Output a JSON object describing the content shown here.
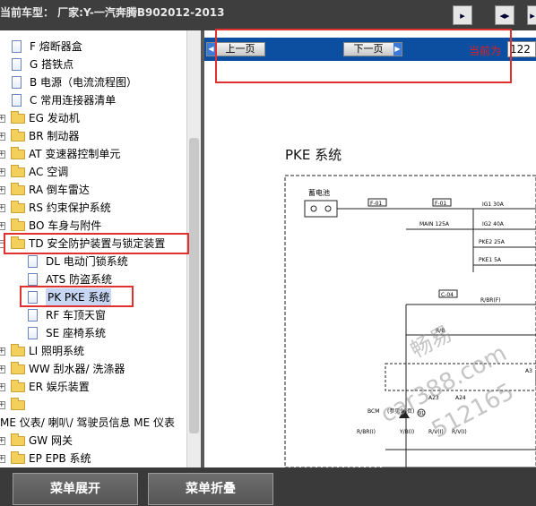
{
  "header": {
    "title": "当前车型：  厂家:Y-一汽奔腾B902012-2013",
    "buttons": [
      {
        "name": "collapse-left-button",
        "glyph": "▸"
      },
      {
        "name": "split-view-button",
        "glyph": "◂▸"
      },
      {
        "name": "expand-right-button",
        "glyph": "▸"
      }
    ]
  },
  "tree": {
    "items": [
      {
        "label": "F 熔断器盒",
        "type": "doc",
        "level": 1
      },
      {
        "label": "G 搭铁点",
        "type": "doc",
        "level": 1
      },
      {
        "label": "B 电源（电流流程图）",
        "type": "doc",
        "level": 1
      },
      {
        "label": "C 常用连接器清单",
        "type": "doc",
        "level": 1
      },
      {
        "label": "EG 发动机",
        "type": "folder",
        "level": 0
      },
      {
        "label": "BR 制动器",
        "type": "folder",
        "level": 0
      },
      {
        "label": "AT 变速器控制单元",
        "type": "folder",
        "level": 0
      },
      {
        "label": "AC 空调",
        "type": "folder",
        "level": 0
      },
      {
        "label": "RA 倒车雷达",
        "type": "folder",
        "level": 0
      },
      {
        "label": "RS 约束保护系统",
        "type": "folder",
        "level": 0
      },
      {
        "label": "BO 车身与附件",
        "type": "folder",
        "level": 0
      },
      {
        "label": "TD 安全防护装置与锁定装置",
        "type": "folder-open",
        "level": 0
      },
      {
        "label": "DL 电动门锁系统",
        "type": "doc",
        "level": 2
      },
      {
        "label": "ATS 防盗系统",
        "type": "doc",
        "level": 2
      },
      {
        "label": "PK PKE 系统",
        "type": "doc",
        "level": 2,
        "selected": true
      },
      {
        "label": "RF 车顶天窗",
        "type": "doc",
        "level": 2
      },
      {
        "label": "SE 座椅系统",
        "type": "doc",
        "level": 2
      },
      {
        "label": "LI 照明系统",
        "type": "folder",
        "level": 0
      },
      {
        "label": "WW 刮水器/ 洗涤器",
        "type": "folder",
        "level": 0
      },
      {
        "label": "ER 娱乐装置",
        "type": "folder",
        "level": 0
      },
      {
        "label": "",
        "type": "folder",
        "level": 0
      },
      {
        "label": "ME 仪表/ 喇叭/ 驾驶员信息 ME 仪表",
        "type": "text",
        "level": 0
      },
      {
        "label": "GW 网关",
        "type": "folder",
        "level": 0
      },
      {
        "label": "EP EPB 系统",
        "type": "folder",
        "level": 0
      }
    ]
  },
  "nav": {
    "prev_label": "上一页",
    "next_label": "下一页",
    "current_label": "当前为",
    "current_page": "122"
  },
  "diagram": {
    "title": "PKE 系统",
    "battery_label": "蓄电池",
    "labels": {
      "f01a": "F-01",
      "f01b": "F-01",
      "main": "MAIN 125A",
      "ig1": "IG1 30A",
      "ig2": "IG2 40A",
      "pke2": "PKE2 25A",
      "pke1": "PKE1 5A",
      "c04": "C-04",
      "rbrf": "R/BR(F)",
      "wire_rb": "R/B",
      "a3": "A3",
      "a23": "A23",
      "a24": "A24",
      "bcm": "BCM",
      "bcm_note": "(参见96页)",
      "conn_91": "91",
      "rbr": "R/BR(I)",
      "ybi": "Y/B(I)",
      "rvi": "R/V(I)",
      "rvi2": "R/V(I)"
    }
  },
  "watermark": {
    "line1": "畅易",
    "line2": "car388.com",
    "line3": "512165"
  },
  "footer": {
    "expand_label": "菜单展开",
    "collapse_label": "菜单折叠"
  }
}
